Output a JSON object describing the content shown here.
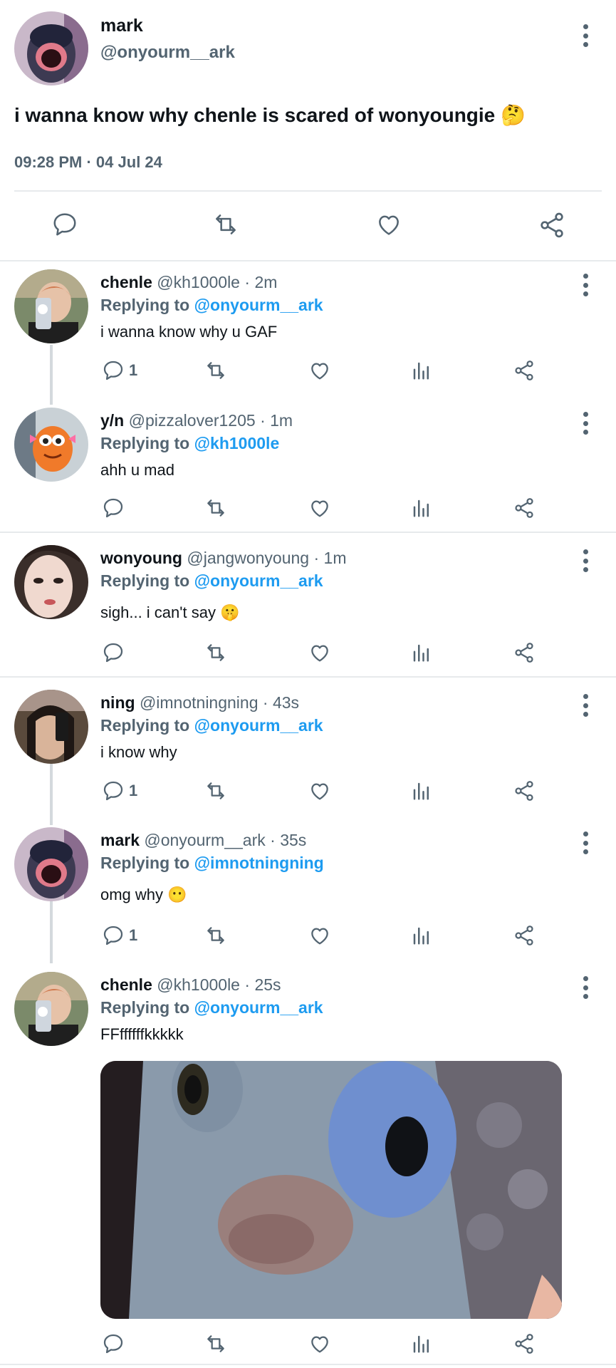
{
  "main_tweet": {
    "name": "mark",
    "handle": "@onyourm__ark",
    "text": "i wanna know why chenle is scared of wonyoungie",
    "emoji": "🤔",
    "timestamp": "09:28 PM · 04 Jul 24"
  },
  "replies": [
    {
      "name": "chenle",
      "handle": "@kh1000le",
      "sep": "·",
      "time": "2m",
      "reply_label": "Replying to",
      "reply_to": "@onyourm__ark",
      "text": "i wanna know why u GAF",
      "emoji": "",
      "reply_count": "1"
    },
    {
      "name": "y/n",
      "handle": "@pizzalover1205",
      "sep": "·",
      "time": "1m",
      "reply_label": "Replying to",
      "reply_to": "@kh1000le",
      "text": "ahh u mad",
      "emoji": "",
      "reply_count": ""
    },
    {
      "name": "wonyoung",
      "handle": "@jangwonyoung",
      "sep": "·",
      "time": "1m",
      "reply_label": "Replying to",
      "reply_to": "@onyourm__ark",
      "text": "sigh... i can't say",
      "emoji": "🤫",
      "reply_count": ""
    },
    {
      "name": "ning",
      "handle": "@imnotningning",
      "sep": "·",
      "time": "43s",
      "reply_label": "Replying to",
      "reply_to": "@onyourm__ark",
      "text": "i know why",
      "emoji": "",
      "reply_count": "1"
    },
    {
      "name": "mark",
      "handle": "@onyourm__ark",
      "sep": "·",
      "time": "35s",
      "reply_label": "Replying to",
      "reply_to": "@imnotningning",
      "text": "omg why",
      "emoji": "😶",
      "reply_count": "1"
    },
    {
      "name": "chenle",
      "handle": "@kh1000le",
      "sep": "·",
      "time": "25s",
      "reply_label": "Replying to",
      "reply_to": "@onyourm__ark",
      "text": "FFffffffkkkkk",
      "emoji": "",
      "reply_count": ""
    }
  ],
  "icons": [
    "comment-icon",
    "retweet-icon",
    "like-icon",
    "views-icon",
    "share-icon",
    "more-icon"
  ],
  "colors": {
    "link": "#1d9bf0",
    "muted": "#536471",
    "divider": "#e7eaec"
  }
}
